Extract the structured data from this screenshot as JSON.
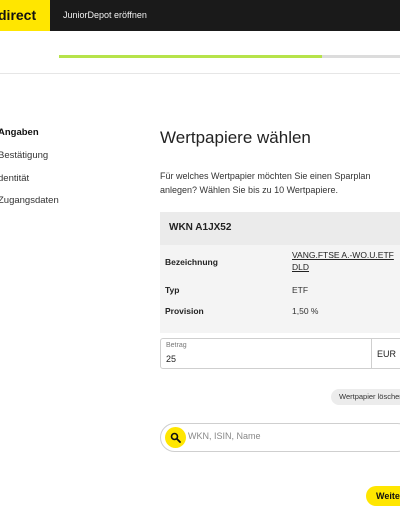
{
  "header": {
    "brand": "direct",
    "title": "JuniorDepot eröffnen"
  },
  "progress": {
    "fraction": 0.77
  },
  "sidebar": {
    "items": [
      {
        "label": "Angaben",
        "active": true
      },
      {
        "label": "Bestätigung",
        "active": false
      },
      {
        "label": "dentität",
        "active": false
      },
      {
        "label": "Zugangsdaten",
        "active": false
      }
    ]
  },
  "main": {
    "title": "Wertpapiere wählen",
    "intro": "Für welches Wertpapier möchten Sie einen Sparplan anlegen? Wählen Sie bis zu 10 Wertpapiere."
  },
  "security": {
    "wkn": "WKN A1JX52",
    "rows": [
      {
        "label": "Bezeichnung",
        "value": "VANG.FTSE A.-WO.U.ETF DLD"
      },
      {
        "label": "Typ",
        "value": "ETF"
      },
      {
        "label": "Provision",
        "value": "1,50 %"
      }
    ]
  },
  "amount": {
    "label": "Betrag",
    "value": "25",
    "currency": "EUR"
  },
  "delete_button": "Wertpapier löschen",
  "search": {
    "placeholder": "WKN, ISIN, Name"
  },
  "next_button": "Weiter",
  "colors": {
    "brand": "#ffe600",
    "header_bg": "#1a1a1a",
    "progress": "#b6e34a"
  }
}
